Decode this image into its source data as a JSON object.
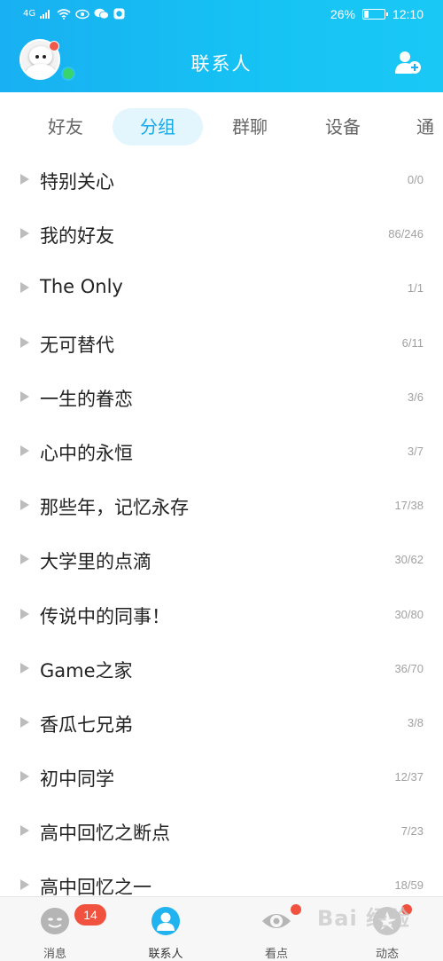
{
  "statusbar": {
    "network": "4G",
    "battery": "26%",
    "battery_level": 0.26,
    "time": "12:10"
  },
  "header": {
    "title": "联系人",
    "add_icon": "add-contact-icon",
    "avatar_icon": "robot-avatar"
  },
  "tabs": [
    {
      "label": "好友",
      "active": false
    },
    {
      "label": "分组",
      "active": true
    },
    {
      "label": "群聊",
      "active": false
    },
    {
      "label": "设备",
      "active": false
    },
    {
      "label": "通讯",
      "active": false
    }
  ],
  "groups": [
    {
      "name": "特别关心",
      "count": "0/0"
    },
    {
      "name": "我的好友",
      "count": "86/246"
    },
    {
      "name": "The Only",
      "count": "1/1"
    },
    {
      "name": "无可替代",
      "count": "6/11"
    },
    {
      "name": "一生的眷恋",
      "count": "3/6"
    },
    {
      "name": "心中的永恒",
      "count": "3/7"
    },
    {
      "name": "那些年，记忆永存",
      "count": "17/38"
    },
    {
      "name": "大学里的点滴",
      "count": "30/62"
    },
    {
      "name": "传说中的同事！",
      "count": "30/80"
    },
    {
      "name": "Game之家",
      "count": "36/70"
    },
    {
      "name": "香瓜七兄弟",
      "count": "3/8"
    },
    {
      "name": "初中同学",
      "count": "12/37"
    },
    {
      "name": "高中回忆之断点",
      "count": "7/23"
    },
    {
      "name": "高中回忆之一",
      "count": "18/59"
    }
  ],
  "bottom_nav": [
    {
      "label": "消息",
      "icon": "message-icon",
      "badge": "14",
      "active": false
    },
    {
      "label": "联系人",
      "icon": "contacts-icon",
      "badge": "",
      "active": true
    },
    {
      "label": "看点",
      "icon": "eye-icon",
      "badge": "",
      "active": false
    },
    {
      "label": "动态",
      "icon": "star-icon",
      "badge": "",
      "active": false
    }
  ],
  "watermark": "Bai 经验",
  "colors": {
    "header": "#18b0f2",
    "accent": "#15a8e8",
    "badge": "#f0523f",
    "online": "#39d46a"
  }
}
